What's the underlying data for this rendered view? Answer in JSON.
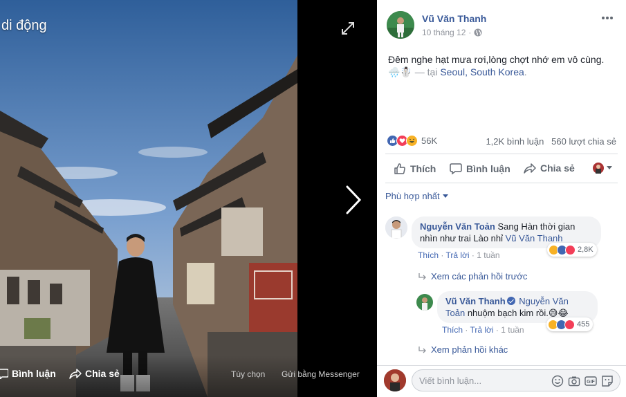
{
  "photo": {
    "title": "di động",
    "actions": {
      "comment": "Bình luận",
      "share": "Chia sẻ",
      "options": "Tùy chọn",
      "send_messenger": "Gửi bằng Messenger"
    }
  },
  "post": {
    "author": "Vũ Văn Thanh",
    "date": "10 tháng 12",
    "text": "Đêm nghe hạt mưa rơi,lòng chợt nhớ em vô cùng.",
    "emoji": "🌧️☃️",
    "location_prefix": "— tại",
    "location": "Seoul, South Korea",
    "location_suffix": "."
  },
  "stats": {
    "reaction_count": "56K",
    "comments": "1,2K bình luận",
    "shares": "560 lượt chia sẻ"
  },
  "actions": {
    "like": "Thích",
    "comment": "Bình luận",
    "share": "Chia sẻ"
  },
  "sort": {
    "label": "Phù hợp nhất"
  },
  "comments": [
    {
      "name": "Nguyễn Văn Toản",
      "text": "Sang Hàn thời gian nhìn như trai Lào nhỉ",
      "tag": "Vũ Văn Thanh",
      "reaction_count": "2,8K",
      "like": "Thích",
      "reply": "Trả lời",
      "time": "1 tuần"
    }
  ],
  "earlier_replies": "Xem các phản hồi trước",
  "reply": {
    "name": "Vũ Văn Thanh",
    "tag": "Nguyễn Văn Toản",
    "text": "nhuộm bạch kim rồi.",
    "emoji": "😅😂",
    "reaction_count": "455",
    "like": "Thích",
    "reply": "Trả lời",
    "time": "1 tuần"
  },
  "more_replies": "Xem phản hồi khác",
  "composer": {
    "placeholder": "Viết bình luận..."
  },
  "colors": {
    "link": "#385898",
    "like_blue": "#4267b2",
    "love_red": "#f33e58",
    "haha_yellow": "#f7b125",
    "muted": "#90949c"
  }
}
